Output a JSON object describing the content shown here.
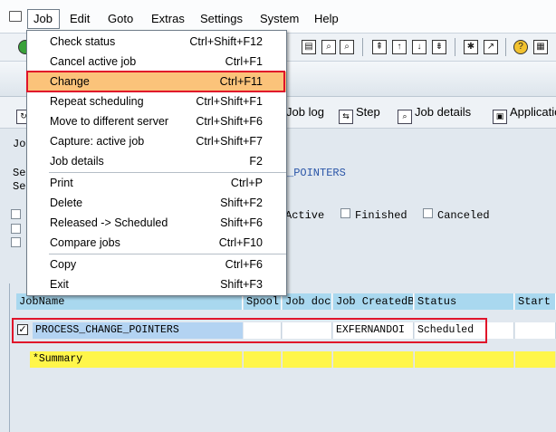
{
  "menubar": {
    "items": [
      {
        "label": "Job",
        "u": "J"
      },
      {
        "label": "Edit",
        "u": "E"
      },
      {
        "label": "Goto",
        "u": "G"
      },
      {
        "label": "Extras",
        "u": "x"
      },
      {
        "label": "Settings",
        "u": "S"
      },
      {
        "label": "System",
        "u": "y"
      },
      {
        "label": "Help",
        "u": "H"
      }
    ]
  },
  "job_menu": {
    "items": [
      {
        "label": "Check status",
        "shortcut": "Ctrl+Shift+F12"
      },
      {
        "label": "Cancel active job",
        "shortcut": "Ctrl+F1"
      },
      {
        "label": "Change",
        "shortcut": "Ctrl+F11"
      },
      {
        "label": "Repeat scheduling",
        "shortcut": "Ctrl+Shift+F1"
      },
      {
        "label": "Move to different server",
        "shortcut": "Ctrl+Shift+F6"
      },
      {
        "label": "Capture: active job",
        "shortcut": "Ctrl+Shift+F7"
      },
      {
        "label": "Job details",
        "shortcut": "F2"
      },
      {
        "label": "Print",
        "shortcut": "Ctrl+P"
      },
      {
        "label": "Delete",
        "shortcut": "Shift+F2"
      },
      {
        "label": "Released -> Scheduled",
        "shortcut": "Shift+F6"
      },
      {
        "label": "Compare jobs",
        "shortcut": "Ctrl+F10"
      },
      {
        "label": "Copy",
        "shortcut": "Ctrl+F6"
      },
      {
        "label": "Exit",
        "shortcut": "Shift+F3"
      }
    ]
  },
  "app_toolbar": {
    "job_log": "Job log",
    "step": "Step",
    "job_details": "Job details",
    "application": "Application"
  },
  "content": {
    "left_label_1": "Jo",
    "left_label_2": "Se",
    "left_label_3": "Se",
    "selection_text": "_POINTERS",
    "status_active": "Active",
    "status_finished": "Finished",
    "status_canceled": "Canceled"
  },
  "table": {
    "columns": [
      "JobName",
      "Spool",
      "Job doc",
      "Job CreatedB",
      "Status",
      "Start"
    ],
    "row": {
      "selected": true,
      "jobname": "PROCESS_CHANGE_POINTERS",
      "spool": "",
      "job_doc": "",
      "created_by": "EXFERNANDOI",
      "status": "Scheduled"
    },
    "summary": "*Summary"
  },
  "colors": {
    "highlight": "#e0142a",
    "menu_active": "#fbc37a",
    "header": "#a9d8ef",
    "summary": "#fff64a"
  }
}
